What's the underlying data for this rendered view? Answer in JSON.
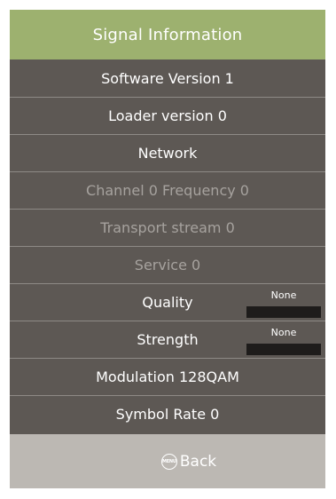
{
  "header": {
    "title": "Signal Information"
  },
  "rows": [
    {
      "label": "Software Version 1"
    },
    {
      "label": "Loader version 0"
    },
    {
      "label": "Network"
    },
    {
      "label": "Channel 0 Frequency 0"
    },
    {
      "label": "Transport stream 0"
    },
    {
      "label": "Service 0"
    },
    {
      "label": "Quality",
      "meter_text": "None",
      "meter_level": 0
    },
    {
      "label": "Strength",
      "meter_text": "None",
      "meter_level": 0
    },
    {
      "label": "Modulation 128QAM"
    },
    {
      "label": "Symbol Rate 0"
    }
  ],
  "footer": {
    "back_icon": "menu-icon",
    "menu_icon_text": "MENU",
    "back_label": "Back"
  },
  "colors": {
    "header_bg": "#9db16f",
    "panel_bg": "#5d5854",
    "footer_bg": "#bcb8b3",
    "dim_text": "#a6a29e",
    "meter_bg": "#1e1c1b"
  }
}
